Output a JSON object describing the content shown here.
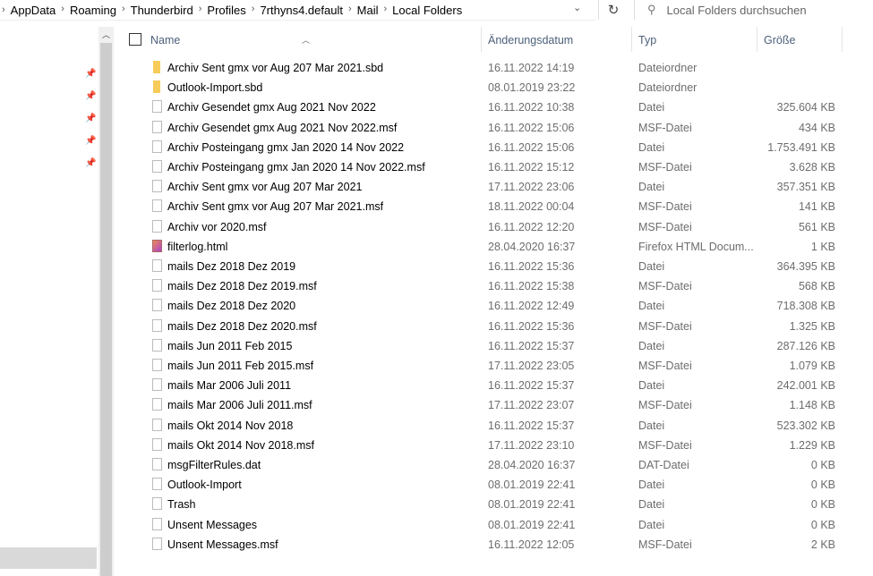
{
  "breadcrumb": [
    "AppData",
    "Roaming",
    "Thunderbird",
    "Profiles",
    "7rthyns4.default",
    "Mail",
    "Local Folders"
  ],
  "search": {
    "placeholder": "Local Folders durchsuchen"
  },
  "columns": {
    "name": "Name",
    "date": "Änderungsdatum",
    "type": "Typ",
    "size": "Größe"
  },
  "files": [
    {
      "name": "Archiv Sent gmx vor Aug 207 Mar 2021.sbd",
      "date": "16.11.2022 14:19",
      "type": "Dateiordner",
      "size": "",
      "icon": "folder"
    },
    {
      "name": "Outlook-Import.sbd",
      "date": "08.01.2019 23:22",
      "type": "Dateiordner",
      "size": "",
      "icon": "folder"
    },
    {
      "name": "Archiv Gesendet gmx Aug 2021 Nov 2022",
      "date": "16.11.2022 10:38",
      "type": "Datei",
      "size": "325.604 KB",
      "icon": "file"
    },
    {
      "name": "Archiv Gesendet gmx Aug 2021 Nov 2022.msf",
      "date": "16.11.2022 15:06",
      "type": "MSF-Datei",
      "size": "434 KB",
      "icon": "file"
    },
    {
      "name": "Archiv Posteingang gmx Jan 2020 14 Nov 2022",
      "date": "16.11.2022 15:06",
      "type": "Datei",
      "size": "1.753.491 KB",
      "icon": "file"
    },
    {
      "name": "Archiv Posteingang gmx Jan 2020 14 Nov 2022.msf",
      "date": "16.11.2022 15:12",
      "type": "MSF-Datei",
      "size": "3.628 KB",
      "icon": "file"
    },
    {
      "name": "Archiv Sent gmx vor Aug 207 Mar 2021",
      "date": "17.11.2022 23:06",
      "type": "Datei",
      "size": "357.351 KB",
      "icon": "file"
    },
    {
      "name": "Archiv Sent gmx vor Aug 207 Mar 2021.msf",
      "date": "18.11.2022 00:04",
      "type": "MSF-Datei",
      "size": "141 KB",
      "icon": "file"
    },
    {
      "name": "Archiv vor 2020.msf",
      "date": "16.11.2022 12:20",
      "type": "MSF-Datei",
      "size": "561 KB",
      "icon": "file"
    },
    {
      "name": "filterlog.html",
      "date": "28.04.2020 16:37",
      "type": "Firefox HTML Docum...",
      "size": "1 KB",
      "icon": "html"
    },
    {
      "name": "mails Dez 2018 Dez 2019",
      "date": "16.11.2022 15:36",
      "type": "Datei",
      "size": "364.395 KB",
      "icon": "file"
    },
    {
      "name": "mails Dez 2018 Dez 2019.msf",
      "date": "16.11.2022 15:38",
      "type": "MSF-Datei",
      "size": "568 KB",
      "icon": "file"
    },
    {
      "name": "mails Dez 2018 Dez 2020",
      "date": "16.11.2022 12:49",
      "type": "Datei",
      "size": "718.308 KB",
      "icon": "file"
    },
    {
      "name": "mails Dez 2018 Dez 2020.msf",
      "date": "16.11.2022 15:36",
      "type": "MSF-Datei",
      "size": "1.325 KB",
      "icon": "file"
    },
    {
      "name": "mails Jun 2011 Feb 2015",
      "date": "16.11.2022 15:37",
      "type": "Datei",
      "size": "287.126 KB",
      "icon": "file"
    },
    {
      "name": "mails Jun 2011 Feb 2015.msf",
      "date": "17.11.2022 23:05",
      "type": "MSF-Datei",
      "size": "1.079 KB",
      "icon": "file"
    },
    {
      "name": "mails Mar 2006 Juli 2011",
      "date": "16.11.2022 15:37",
      "type": "Datei",
      "size": "242.001 KB",
      "icon": "file"
    },
    {
      "name": "mails Mar 2006 Juli 2011.msf",
      "date": "17.11.2022 23:07",
      "type": "MSF-Datei",
      "size": "1.148 KB",
      "icon": "file"
    },
    {
      "name": "mails Okt 2014 Nov 2018",
      "date": "16.11.2022 15:37",
      "type": "Datei",
      "size": "523.302 KB",
      "icon": "file"
    },
    {
      "name": "mails Okt 2014 Nov 2018.msf",
      "date": "17.11.2022 23:10",
      "type": "MSF-Datei",
      "size": "1.229 KB",
      "icon": "file"
    },
    {
      "name": "msgFilterRules.dat",
      "date": "28.04.2020 16:37",
      "type": "DAT-Datei",
      "size": "0 KB",
      "icon": "file"
    },
    {
      "name": "Outlook-Import",
      "date": "08.01.2019 22:41",
      "type": "Datei",
      "size": "0 KB",
      "icon": "file"
    },
    {
      "name": "Trash",
      "date": "08.01.2019 22:41",
      "type": "Datei",
      "size": "0 KB",
      "icon": "file"
    },
    {
      "name": "Unsent Messages",
      "date": "08.01.2019 22:41",
      "type": "Datei",
      "size": "0 KB",
      "icon": "file"
    },
    {
      "name": "Unsent Messages.msf",
      "date": "16.11.2022 12:05",
      "type": "MSF-Datei",
      "size": "2 KB",
      "icon": "file"
    }
  ]
}
